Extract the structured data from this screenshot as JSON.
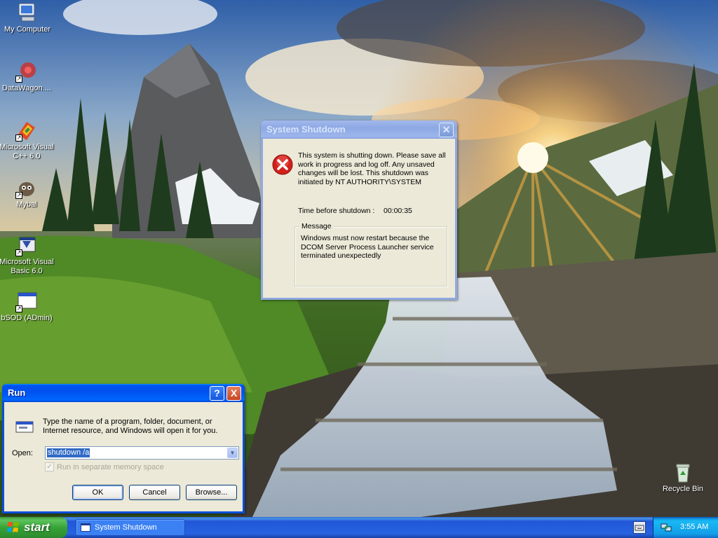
{
  "desktop": {
    "icons": [
      {
        "label": "My Computer",
        "icon": "computer-icon"
      },
      {
        "label": "DataWagon....",
        "icon": "datawagon-icon"
      },
      {
        "label": "Microsoft Visual C++ 6.0",
        "icon": "visual-cpp-icon"
      },
      {
        "label": "Mybal",
        "icon": "mybal-icon"
      },
      {
        "label": "Microsoft Visual Basic 6.0",
        "icon": "visual-basic-icon"
      },
      {
        "label": "bSOD (ADmin)",
        "icon": "program-window-icon"
      },
      {
        "label": "Recycle Bin",
        "icon": "recycle-bin-icon"
      }
    ]
  },
  "shutdown_dialog": {
    "title": "System Shutdown",
    "warning_lines": [
      "This system is shutting down. Please save all",
      "work in progress and log off. Any unsaved",
      "changes will be lost. This shutdown was",
      "initiated by NT AUTHORITY\\SYSTEM"
    ],
    "time_label": "Time before shutdown :",
    "time_value": "00:00:35",
    "message_legend": "Message",
    "message_lines": [
      "Windows must now restart because the",
      "DCOM Server Process Launcher service",
      "terminated unexpectedly"
    ],
    "icon": "error-icon"
  },
  "run_dialog": {
    "title": "Run",
    "description_lines": [
      "Type the name of a program, folder, document, or",
      "Internet resource, and Windows will open it for you."
    ],
    "open_label": "Open:",
    "open_value": "shutdown /a",
    "checkbox_label": "Run in separate memory space",
    "ok_label": "OK",
    "cancel_label": "Cancel",
    "browse_label": "Browse...",
    "help_label": "?",
    "close_label": "X"
  },
  "taskbar": {
    "start_label": "start",
    "items": [
      {
        "label": "System Shutdown"
      }
    ],
    "clock": "3:55 AM"
  },
  "colors": {
    "xp_blue": "#0053ee",
    "start_green": "#36a336",
    "dialog_face": "#ece9d8",
    "error_red": "#d2201c"
  }
}
